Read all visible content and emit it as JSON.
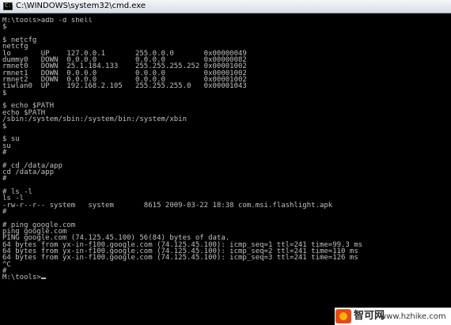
{
  "window": {
    "title": "C:\\WINDOWS\\system32\\cmd.exe",
    "background": "#000000",
    "text_color": "#c0c0c0",
    "titlebar_color": "#e4e9ef"
  },
  "console": {
    "lines": [
      "M:\\tools>adb -d shell",
      "$",
      "",
      "$ netcfg",
      "netcfg",
      "lo       UP    127.0.0.1       255.0.0.0       0x00000049",
      "dummy0   DOWN  0.0.0.0         0.0.0.0         0x00000082",
      "rmnet0   DOWN  25.1.184.133    255.255.255.252 0x00001002",
      "rmnet1   DOWN  0.0.0.0         0.0.0.0         0x00001002",
      "rmnet2   DOWN  0.0.0.0         0.0.0.0         0x00001002",
      "tiwlan0  UP    192.168.2.105   255.255.255.0   0x00001043",
      "$",
      "",
      "$ echo $PATH",
      "echo $PATH",
      "/sbin:/system/sbin:/system/bin:/system/xbin",
      "$",
      "",
      "$ su",
      "su",
      "#",
      "",
      "# cd /data/app",
      "cd /data/app",
      "#",
      "",
      "# ls -l",
      "ls -l",
      "-rw-r--r-- system   system       8615 2009-03-22 18:38 com.msi.flashlight.apk",
      "#",
      "",
      "# ping google.com",
      "ping google.com",
      "PING google.com (74.125.45.100) 56(84) bytes of data.",
      "64 bytes from yx-in-f100.google.com (74.125.45.100): icmp_seq=1 ttl=241 time=99.3 ms",
      "64 bytes from yx-in-f100.google.com (74.125.45.100): icmp_seq=2 ttl=241 time=110 ms",
      "64 bytes from yx-in-f100.google.com (74.125.45.100): icmp_seq=3 ttl=241 time=126 ms",
      "^C",
      "#",
      "M:\\tools>"
    ]
  },
  "watermark": {
    "brand": "智可网",
    "url": "www.hzhike.com"
  }
}
